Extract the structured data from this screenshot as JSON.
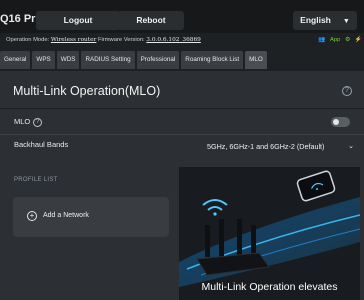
{
  "header": {
    "brand": "Q16 Pro",
    "logout_label": "Logout",
    "reboot_label": "Reboot",
    "language": "English"
  },
  "status": {
    "operation_mode_label": "Operation Mode:",
    "operation_mode_value": "Wireless router",
    "firmware_label": "Firmware Version:",
    "firmware_value": "3.0.0.6.102_36869",
    "app_label": "App"
  },
  "tabs": [
    {
      "label": "General"
    },
    {
      "label": "WPS"
    },
    {
      "label": "WDS"
    },
    {
      "label": "RADIUS Setting"
    },
    {
      "label": "Professional"
    },
    {
      "label": "Roaming Block List"
    },
    {
      "label": "MLO"
    }
  ],
  "panel": {
    "title": "Multi-Link Operation(MLO)",
    "mlo_label": "MLO",
    "mlo_enabled": false,
    "backhaul_label": "Backhaul Bands",
    "backhaul_value": "5GHz, 6GHz-1 and 6GHz-2 (Default)",
    "profile_list_title": "PROFILE LIST",
    "add_network_label": "Add a Network",
    "promo_text": "Multi-Link Operation elevates"
  },
  "colors": {
    "accent_green": "#6ecf3a",
    "promo_glow": "#1ea6ff"
  }
}
